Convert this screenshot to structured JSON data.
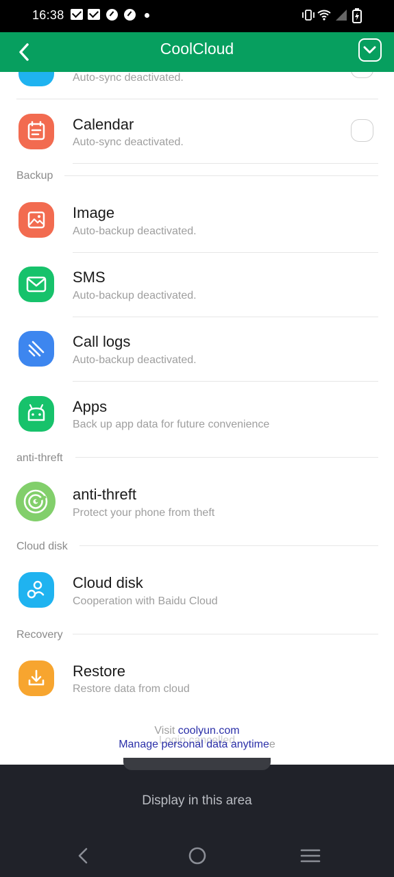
{
  "status_bar": {
    "time": "16:38",
    "left_icons": [
      "mail-icon",
      "mail-icon",
      "gauge-icon",
      "gauge-icon",
      "dot-icon"
    ],
    "right_icons": [
      "vibrate-icon",
      "wifi-icon",
      "signal-icon",
      "battery-charging-icon"
    ]
  },
  "app_bar": {
    "title": "CoolCloud",
    "back_icon": "chevron-left-icon",
    "confirm_icon": "check-chevron-icon",
    "color": "#079f5f"
  },
  "sync": {
    "items": [
      {
        "title": "",
        "subtitle": "Auto-sync deactivated.",
        "icon": "contacts-icon",
        "color": "#1fb3f0"
      },
      {
        "title": "Calendar",
        "subtitle": "Auto-sync deactivated.",
        "icon": "calendar-icon",
        "color": "#f26b50"
      }
    ]
  },
  "backup": {
    "label": "Backup",
    "items": [
      {
        "title": "Image",
        "subtitle": "Auto-backup deactivated.",
        "icon": "image-icon",
        "color": "#f26b50"
      },
      {
        "title": "SMS",
        "subtitle": "Auto-backup deactivated.",
        "icon": "mail-envelope-icon",
        "color": "#17c26b"
      },
      {
        "title": "Call logs",
        "subtitle": "Auto-backup deactivated.",
        "icon": "call-log-icon",
        "color": "#3d86ef"
      },
      {
        "title": "Apps",
        "subtitle": "Back up app data for future convenience",
        "icon": "android-icon",
        "color": "#17c26b"
      }
    ]
  },
  "anti_theft": {
    "label": "anti-threft",
    "items": [
      {
        "title": "anti-threft",
        "subtitle": "Protect your phone from theft",
        "icon": "target-icon",
        "color": "#82cf6b"
      }
    ]
  },
  "cloud_disk": {
    "label": "Cloud disk",
    "items": [
      {
        "title": "Cloud disk",
        "subtitle": "Cooperation with Baidu Cloud",
        "icon": "cloud-disk-icon",
        "color": "#1fb3f0"
      }
    ]
  },
  "recovery": {
    "label": "Recovery",
    "items": [
      {
        "title": "Restore",
        "subtitle": "Restore data from cloud",
        "icon": "download-icon",
        "color": "#f7a52f"
      }
    ]
  },
  "footer": {
    "visit_prefix": "Visit",
    "visit_link": "coolyun.com",
    "manage_text": "Manage personal data anytime",
    "ghost_text": "Login cancelled",
    "ghost_suffix": "e"
  },
  "toast_area": {
    "text": "Display in this area"
  },
  "nav_bar": {
    "back_icon": "nav-back-icon",
    "home_icon": "nav-home-icon",
    "menu_icon": "nav-menu-icon"
  }
}
